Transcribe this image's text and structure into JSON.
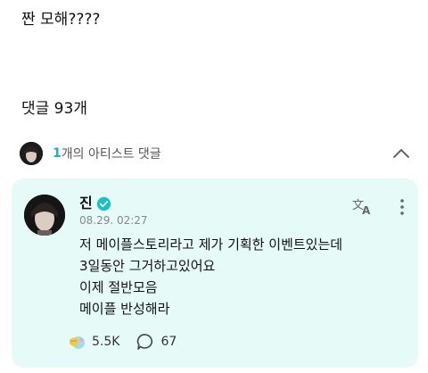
{
  "post": {
    "text": "짠 모해????"
  },
  "comments": {
    "header": "댓글 93개"
  },
  "artist_section": {
    "count": "1",
    "label": "개의 아티스트 댓글"
  },
  "artist_comment": {
    "name": "진",
    "timestamp": "08.29. 02:27",
    "lines": [
      "저 메이플스토리라고 제가 기획한 이벤트있는데",
      "3일동안 그거하고있어요",
      "이제 절반모음",
      "메이플 반성해라"
    ],
    "likes": "5.5K",
    "replies": "67"
  },
  "colors": {
    "accent": "#16b2c3",
    "card_bg": "#e6faf7",
    "verified": "#17c1c7"
  },
  "icons": [
    "chevron-up-icon",
    "verified-badge-icon",
    "translate-icon",
    "more-vertical-icon",
    "like-reaction-icon",
    "reply-bubble-icon"
  ]
}
